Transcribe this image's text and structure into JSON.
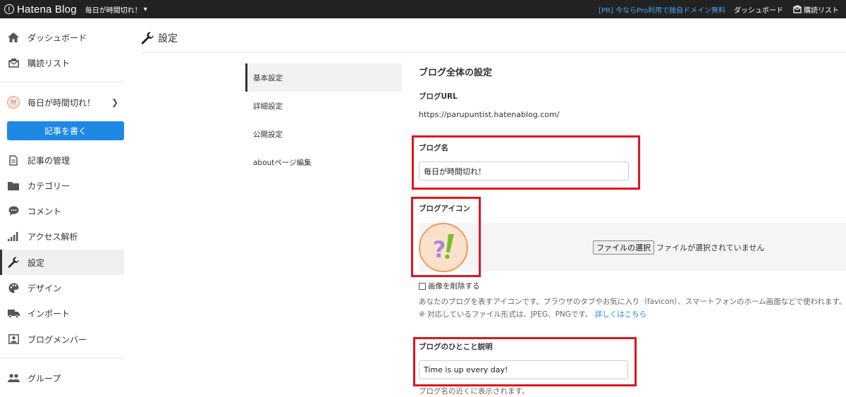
{
  "topbar": {
    "logo_text": "Hatena Blog",
    "blog_name": "毎日が時間切れ！",
    "pr_link": "[PR] 今ならPro利用で独自ドメイン無料",
    "dashboard": "ダッシュボード",
    "reading_list": "購読リスト"
  },
  "sidebar": {
    "dashboard": "ダッシュボード",
    "reading_list": "購読リスト",
    "blog_name": "毎日が時間切れ！",
    "write_button": "記事を書く",
    "manage_posts": "記事の管理",
    "categories": "カテゴリー",
    "comments": "コメント",
    "analytics": "アクセス解析",
    "settings": "設定",
    "design": "デザイン",
    "import": "インポート",
    "members": "ブログメンバー",
    "groups": "グループ"
  },
  "page": {
    "title": "設定"
  },
  "sub_nav": {
    "items": [
      "基本設定",
      "詳細設定",
      "公開設定",
      "aboutページ編集"
    ]
  },
  "form": {
    "section_title": "ブログ全体の設定",
    "url_label": "ブログURL",
    "url_value": "https://parupuntist.hatenablog.com/",
    "name_label": "ブログ名",
    "name_value": "毎日が時間切れ！",
    "icon_label": "ブログアイコン",
    "file_button": "ファイルの選択",
    "file_status": "ファイルが選択されていません",
    "delete_image": "画像を削除する",
    "icon_help": "あなたのブログを表すアイコンです。ブラウザのタブやお気に入り（favicon）、スマートフォンのホーム画面などで使われます。",
    "format_help": "※ 対応しているファイル形式は、JPEG、PNGです。",
    "format_link": "詳しくはこちら",
    "desc_label": "ブログのひとこと説明",
    "desc_value": "Time is up every day!",
    "desc_help": "ブログ名の近くに表示されます。"
  },
  "colors": {
    "accent": "#1e88e5",
    "highlight": "#e0151f",
    "topbar": "#222222"
  }
}
